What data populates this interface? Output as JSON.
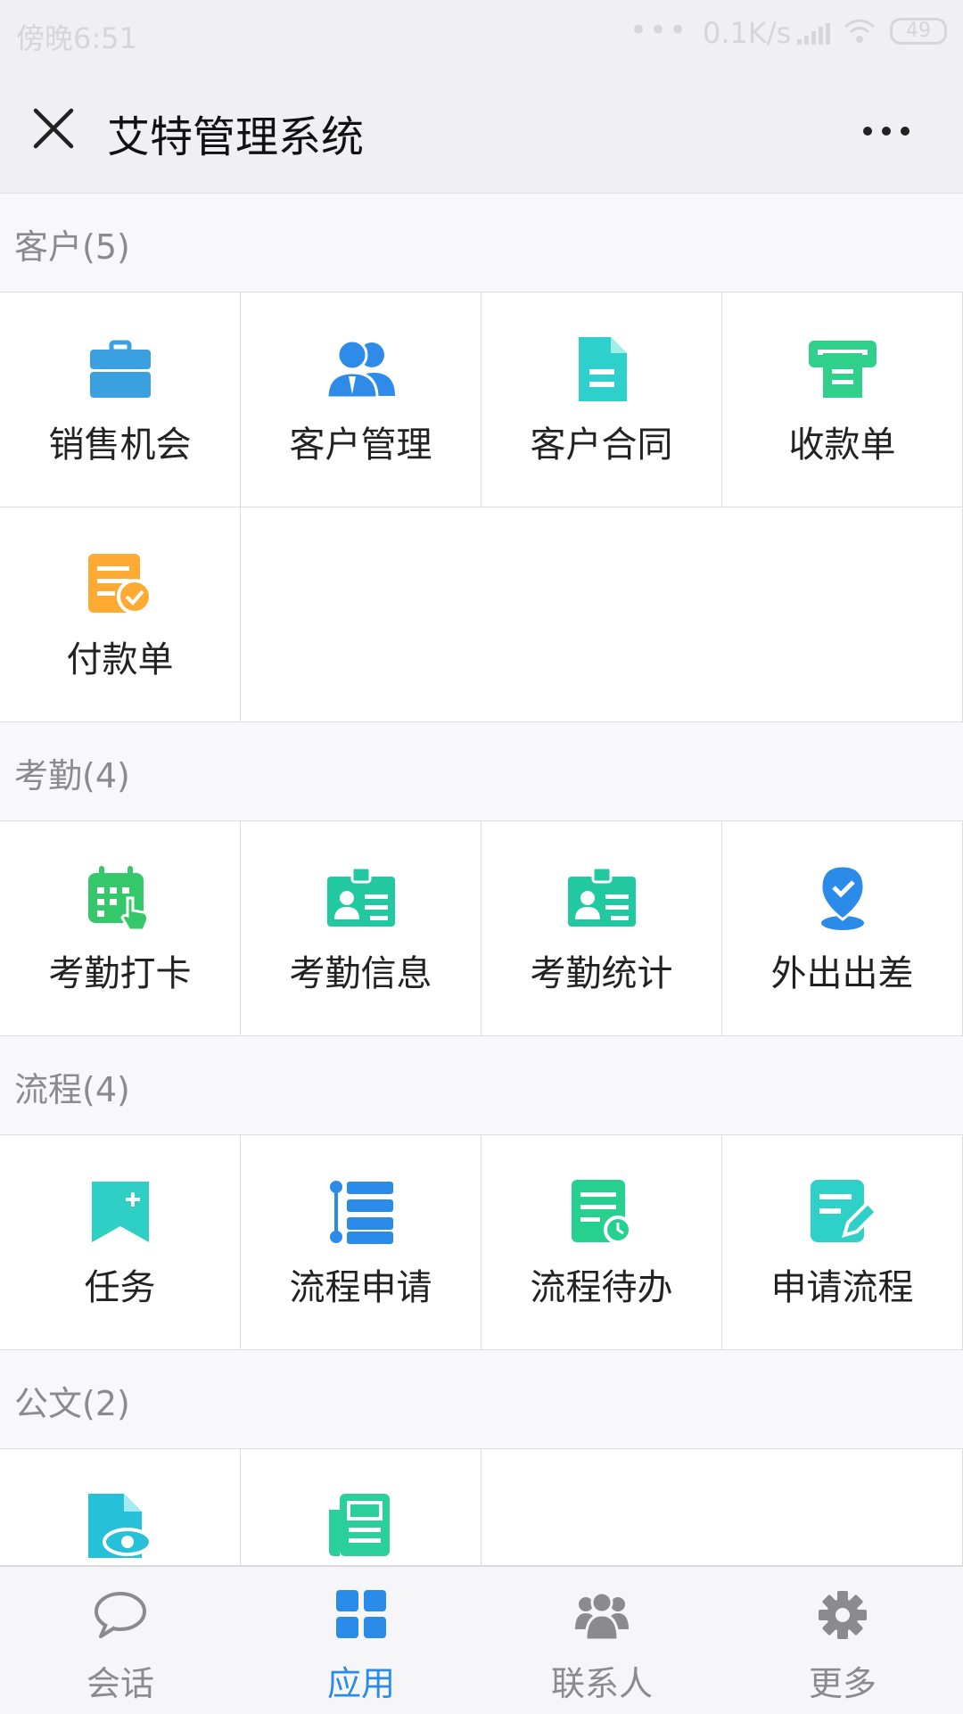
{
  "statusbar": {
    "time": "傍晚6:51",
    "dots": "•••",
    "speed": "0.1K/s",
    "battery": "49"
  },
  "header": {
    "title": "艾特管理系统",
    "close_icon": "close-icon",
    "more_icon": "more-icon"
  },
  "sections": [
    {
      "title": "客户(5)",
      "items": [
        {
          "label": "销售机会",
          "icon": "briefcase-icon",
          "color": "#3aa0e0"
        },
        {
          "label": "客户管理",
          "icon": "users-icon",
          "color": "#2e8be8"
        },
        {
          "label": "客户合同",
          "icon": "document-icon",
          "color": "#2ed0cc"
        },
        {
          "label": "收款单",
          "icon": "receipt-icon",
          "color": "#2ed08a"
        },
        {
          "label": "付款单",
          "icon": "payment-check-icon",
          "color": "#ffaa33"
        }
      ]
    },
    {
      "title": "考勤(4)",
      "items": [
        {
          "label": "考勤打卡",
          "icon": "calendar-tap-icon",
          "color": "#34c86a"
        },
        {
          "label": "考勤信息",
          "icon": "id-card-icon",
          "color": "#22c8a0"
        },
        {
          "label": "考勤统计",
          "icon": "id-card-icon",
          "color": "#22c8a0"
        },
        {
          "label": "外出出差",
          "icon": "location-pin-icon",
          "color": "#2a8be8"
        }
      ]
    },
    {
      "title": "流程(4)",
      "items": [
        {
          "label": "任务",
          "icon": "bookmark-add-icon",
          "color": "#2ecfc4"
        },
        {
          "label": "流程申请",
          "icon": "list-icon",
          "color": "#2a8be8"
        },
        {
          "label": "流程待办",
          "icon": "doc-clock-icon",
          "color": "#26d08e"
        },
        {
          "label": "申请流程",
          "icon": "doc-edit-icon",
          "color": "#2ed0c8"
        }
      ]
    },
    {
      "title": "公文(2)",
      "items": [
        {
          "label": "",
          "icon": "doc-eye-icon",
          "color": "#26c0d8"
        },
        {
          "label": "",
          "icon": "newspaper-icon",
          "color": "#2ad09a"
        }
      ]
    }
  ],
  "tabbar": [
    {
      "label": "会话",
      "icon": "chat-icon",
      "active": false
    },
    {
      "label": "应用",
      "icon": "apps-grid-icon",
      "active": true
    },
    {
      "label": "联系人",
      "icon": "contacts-icon",
      "active": false
    },
    {
      "label": "更多",
      "icon": "gear-icon",
      "active": false
    }
  ],
  "colors": {
    "accent": "#2a8be8",
    "inactive": "#8a8a8f"
  }
}
